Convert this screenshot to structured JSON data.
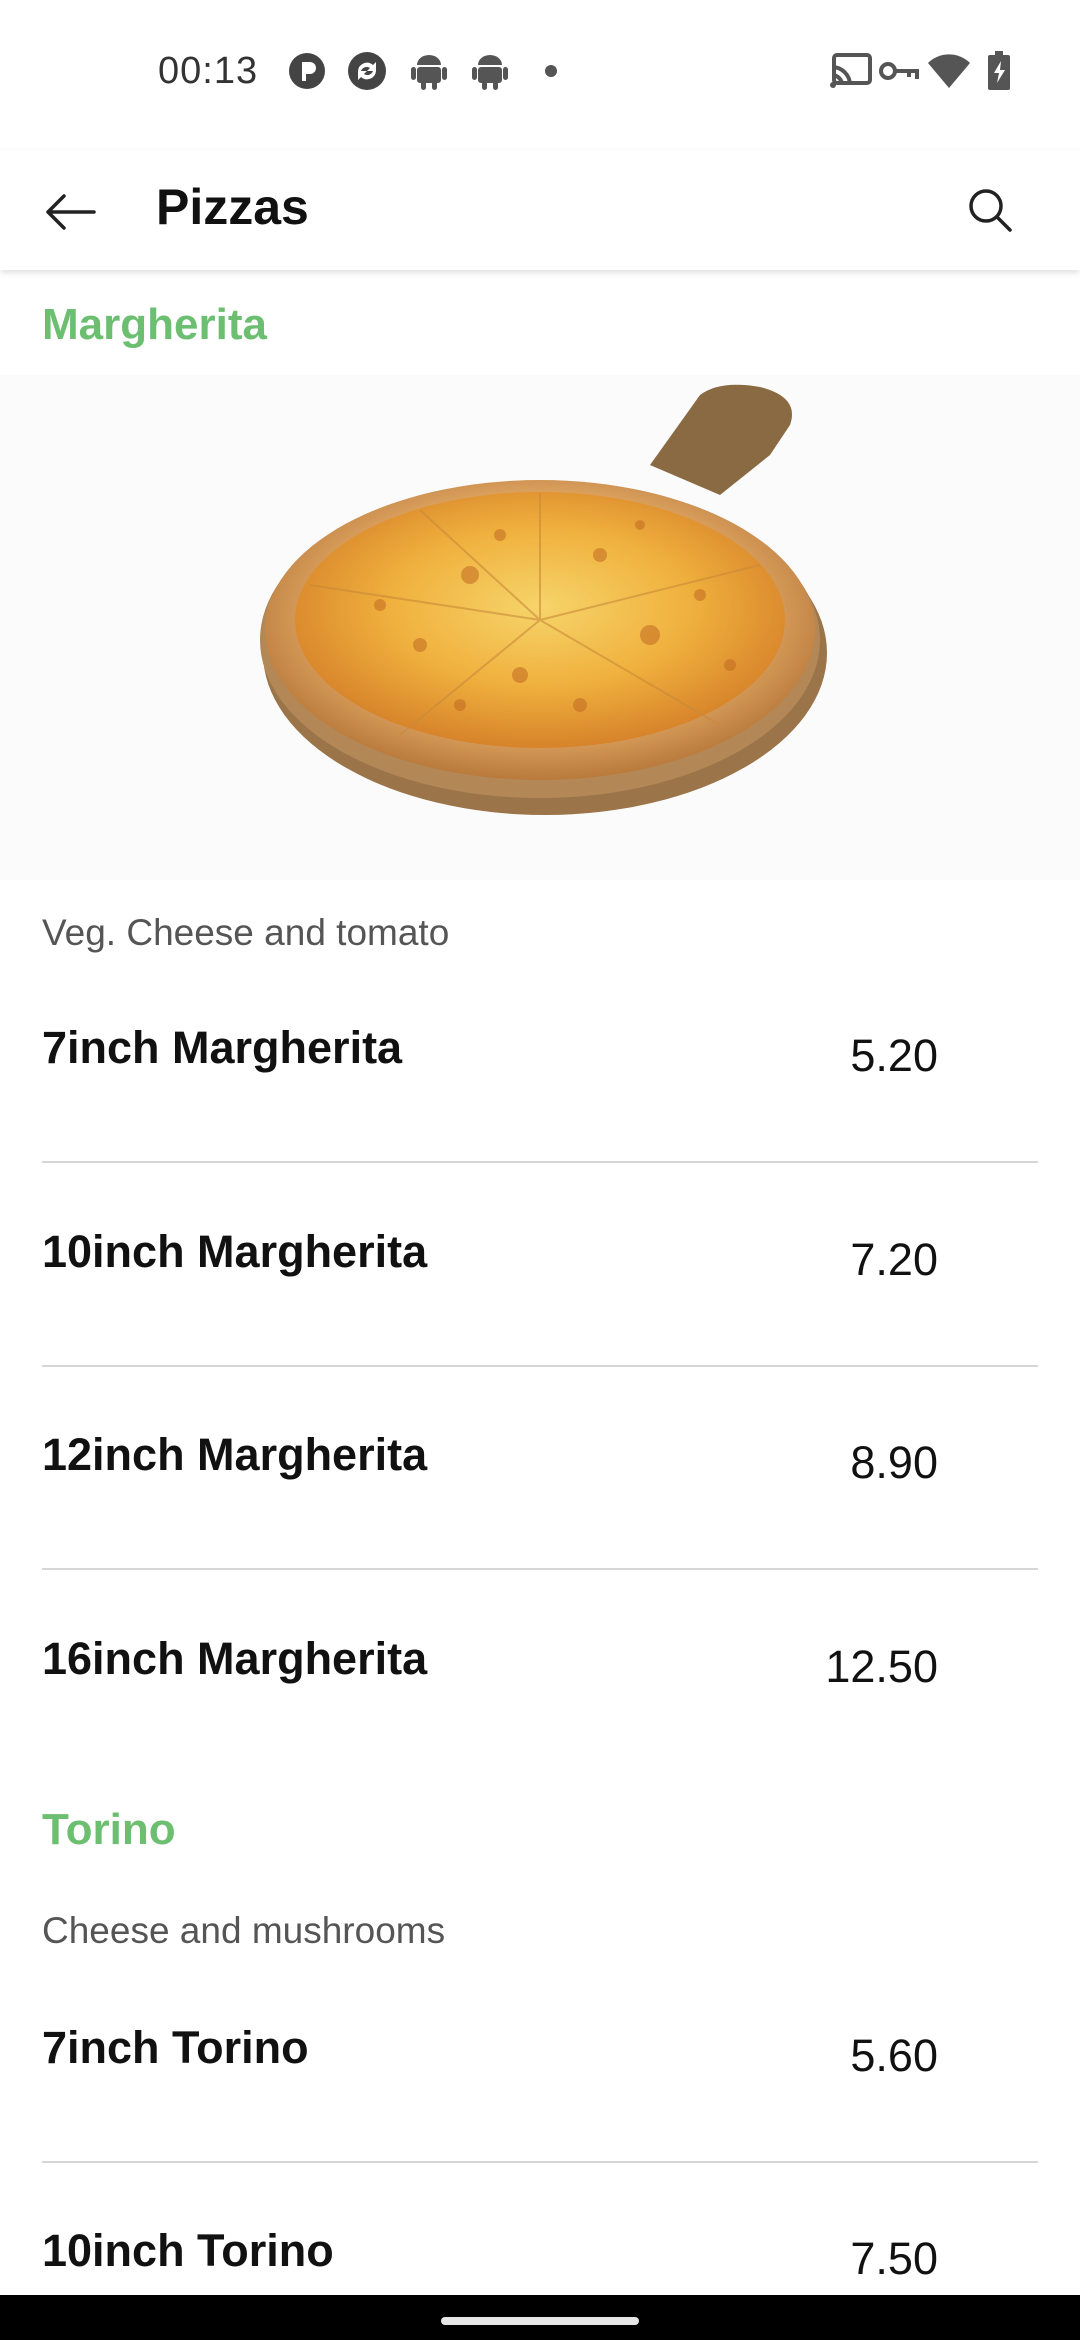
{
  "status_bar": {
    "time": "00:13",
    "left_icons": [
      "app-notification-icon",
      "sync-icon",
      "android-icon",
      "android-icon",
      "dot-icon"
    ],
    "right_icons": [
      "cast-icon",
      "vpn-key-icon",
      "wifi-icon",
      "battery-charging-icon"
    ]
  },
  "app_bar": {
    "title": "Pizzas",
    "back_icon": "arrow-back-icon",
    "search_icon": "search-icon"
  },
  "colors": {
    "section_title": "#6cbf70",
    "divider": "#d6d6d6"
  },
  "sections": [
    {
      "title": "Margherita",
      "description": "Veg. Cheese and tomato",
      "items": [
        {
          "name": "7inch Margherita",
          "price": "5.20"
        },
        {
          "name": "10inch Margherita",
          "price": "7.20"
        },
        {
          "name": "12inch Margherita",
          "price": "8.90"
        },
        {
          "name": "16inch Margherita",
          "price": "12.50"
        }
      ]
    },
    {
      "title": "Torino",
      "description": "Cheese and mushrooms",
      "items": [
        {
          "name": "7inch Torino",
          "price": "5.60"
        },
        {
          "name": "10inch Torino",
          "price": "7.50"
        }
      ]
    }
  ]
}
